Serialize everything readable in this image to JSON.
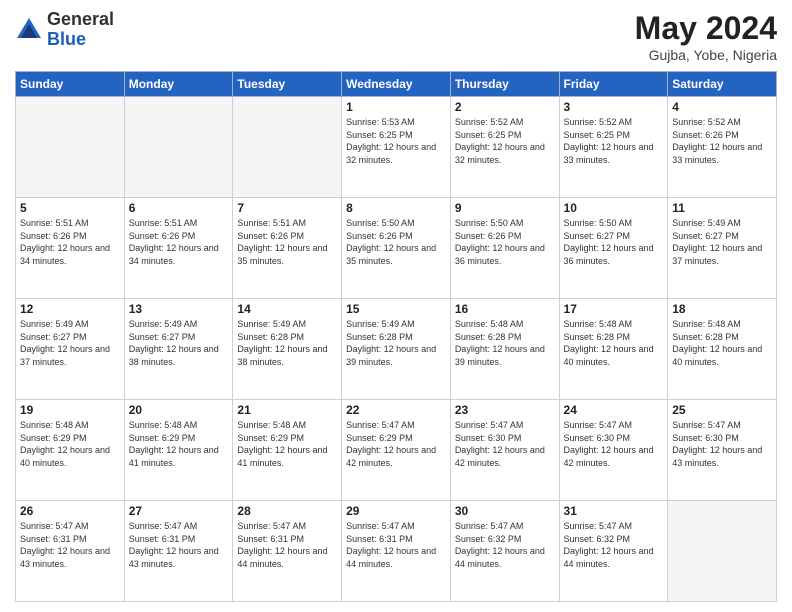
{
  "header": {
    "logo_general": "General",
    "logo_blue": "Blue",
    "month_year": "May 2024",
    "location": "Gujba, Yobe, Nigeria"
  },
  "weekdays": [
    "Sunday",
    "Monday",
    "Tuesday",
    "Wednesday",
    "Thursday",
    "Friday",
    "Saturday"
  ],
  "weeks": [
    [
      {
        "day": "",
        "info": ""
      },
      {
        "day": "",
        "info": ""
      },
      {
        "day": "",
        "info": ""
      },
      {
        "day": "1",
        "info": "Sunrise: 5:53 AM\nSunset: 6:25 PM\nDaylight: 12 hours and 32 minutes."
      },
      {
        "day": "2",
        "info": "Sunrise: 5:52 AM\nSunset: 6:25 PM\nDaylight: 12 hours and 32 minutes."
      },
      {
        "day": "3",
        "info": "Sunrise: 5:52 AM\nSunset: 6:25 PM\nDaylight: 12 hours and 33 minutes."
      },
      {
        "day": "4",
        "info": "Sunrise: 5:52 AM\nSunset: 6:26 PM\nDaylight: 12 hours and 33 minutes."
      }
    ],
    [
      {
        "day": "5",
        "info": "Sunrise: 5:51 AM\nSunset: 6:26 PM\nDaylight: 12 hours and 34 minutes."
      },
      {
        "day": "6",
        "info": "Sunrise: 5:51 AM\nSunset: 6:26 PM\nDaylight: 12 hours and 34 minutes."
      },
      {
        "day": "7",
        "info": "Sunrise: 5:51 AM\nSunset: 6:26 PM\nDaylight: 12 hours and 35 minutes."
      },
      {
        "day": "8",
        "info": "Sunrise: 5:50 AM\nSunset: 6:26 PM\nDaylight: 12 hours and 35 minutes."
      },
      {
        "day": "9",
        "info": "Sunrise: 5:50 AM\nSunset: 6:26 PM\nDaylight: 12 hours and 36 minutes."
      },
      {
        "day": "10",
        "info": "Sunrise: 5:50 AM\nSunset: 6:27 PM\nDaylight: 12 hours and 36 minutes."
      },
      {
        "day": "11",
        "info": "Sunrise: 5:49 AM\nSunset: 6:27 PM\nDaylight: 12 hours and 37 minutes."
      }
    ],
    [
      {
        "day": "12",
        "info": "Sunrise: 5:49 AM\nSunset: 6:27 PM\nDaylight: 12 hours and 37 minutes."
      },
      {
        "day": "13",
        "info": "Sunrise: 5:49 AM\nSunset: 6:27 PM\nDaylight: 12 hours and 38 minutes."
      },
      {
        "day": "14",
        "info": "Sunrise: 5:49 AM\nSunset: 6:28 PM\nDaylight: 12 hours and 38 minutes."
      },
      {
        "day": "15",
        "info": "Sunrise: 5:49 AM\nSunset: 6:28 PM\nDaylight: 12 hours and 39 minutes."
      },
      {
        "day": "16",
        "info": "Sunrise: 5:48 AM\nSunset: 6:28 PM\nDaylight: 12 hours and 39 minutes."
      },
      {
        "day": "17",
        "info": "Sunrise: 5:48 AM\nSunset: 6:28 PM\nDaylight: 12 hours and 40 minutes."
      },
      {
        "day": "18",
        "info": "Sunrise: 5:48 AM\nSunset: 6:28 PM\nDaylight: 12 hours and 40 minutes."
      }
    ],
    [
      {
        "day": "19",
        "info": "Sunrise: 5:48 AM\nSunset: 6:29 PM\nDaylight: 12 hours and 40 minutes."
      },
      {
        "day": "20",
        "info": "Sunrise: 5:48 AM\nSunset: 6:29 PM\nDaylight: 12 hours and 41 minutes."
      },
      {
        "day": "21",
        "info": "Sunrise: 5:48 AM\nSunset: 6:29 PM\nDaylight: 12 hours and 41 minutes."
      },
      {
        "day": "22",
        "info": "Sunrise: 5:47 AM\nSunset: 6:29 PM\nDaylight: 12 hours and 42 minutes."
      },
      {
        "day": "23",
        "info": "Sunrise: 5:47 AM\nSunset: 6:30 PM\nDaylight: 12 hours and 42 minutes."
      },
      {
        "day": "24",
        "info": "Sunrise: 5:47 AM\nSunset: 6:30 PM\nDaylight: 12 hours and 42 minutes."
      },
      {
        "day": "25",
        "info": "Sunrise: 5:47 AM\nSunset: 6:30 PM\nDaylight: 12 hours and 43 minutes."
      }
    ],
    [
      {
        "day": "26",
        "info": "Sunrise: 5:47 AM\nSunset: 6:31 PM\nDaylight: 12 hours and 43 minutes."
      },
      {
        "day": "27",
        "info": "Sunrise: 5:47 AM\nSunset: 6:31 PM\nDaylight: 12 hours and 43 minutes."
      },
      {
        "day": "28",
        "info": "Sunrise: 5:47 AM\nSunset: 6:31 PM\nDaylight: 12 hours and 44 minutes."
      },
      {
        "day": "29",
        "info": "Sunrise: 5:47 AM\nSunset: 6:31 PM\nDaylight: 12 hours and 44 minutes."
      },
      {
        "day": "30",
        "info": "Sunrise: 5:47 AM\nSunset: 6:32 PM\nDaylight: 12 hours and 44 minutes."
      },
      {
        "day": "31",
        "info": "Sunrise: 5:47 AM\nSunset: 6:32 PM\nDaylight: 12 hours and 44 minutes."
      },
      {
        "day": "",
        "info": ""
      }
    ]
  ]
}
